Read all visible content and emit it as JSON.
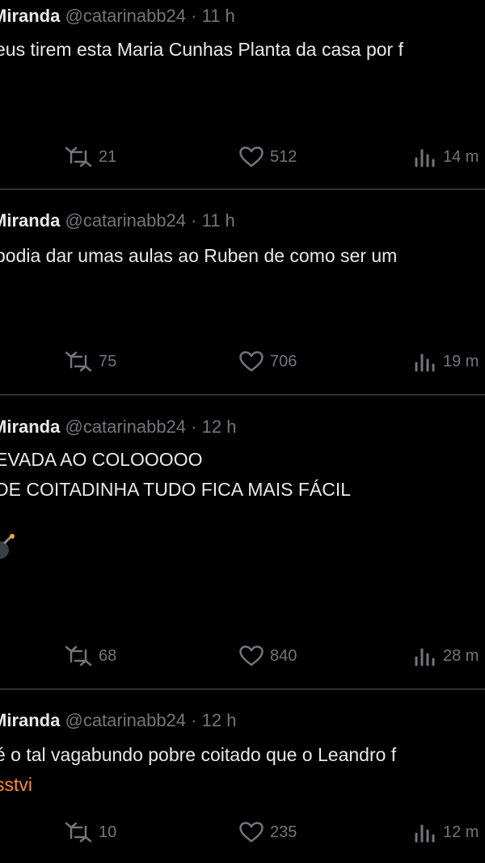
{
  "tweets": [
    {
      "name": "Miranda",
      "handle": "@catarinabb24",
      "separator": "·",
      "time": "11 h",
      "lines": [
        "eus tirem esta Maria Cunhas Planta da casa por f"
      ],
      "link": "",
      "retweets": "21",
      "likes": "512",
      "views": "14 m"
    },
    {
      "name": "Miranda",
      "handle": "@catarinabb24",
      "separator": "·",
      "time": "11 h",
      "lines": [
        " podia dar umas aulas ao Ruben de como ser um"
      ],
      "link": "",
      "retweets": "75",
      "likes": "706",
      "views": "19 m"
    },
    {
      "name": "Miranda",
      "handle": "@catarinabb24",
      "separator": "·",
      "time": "12 h",
      "lines": [
        "EVADA AO COLOOOOO",
        "DE COITADINHA TUDO FICA MAIS FÁCIL"
      ],
      "link": "",
      "emoji": "bomb-emoji",
      "retweets": "68",
      "likes": "840",
      "views": "28 m"
    },
    {
      "name": "Miranda",
      "handle": "@catarinabb24",
      "separator": "·",
      "time": "12 h",
      "lines": [
        "é o tal vagabundo pobre coitado que o Leandro f"
      ],
      "link": "sstvi",
      "retweets": "10",
      "likes": "235",
      "views": "12 m"
    }
  ],
  "icons": {
    "retweet": "retweet-icon",
    "like": "heart-icon",
    "views": "views-icon"
  },
  "colors": {
    "background": "#000000",
    "text": "#e7e9ea",
    "muted": "#71767b",
    "divider": "#2f3336",
    "link": "#ff8a2b"
  }
}
